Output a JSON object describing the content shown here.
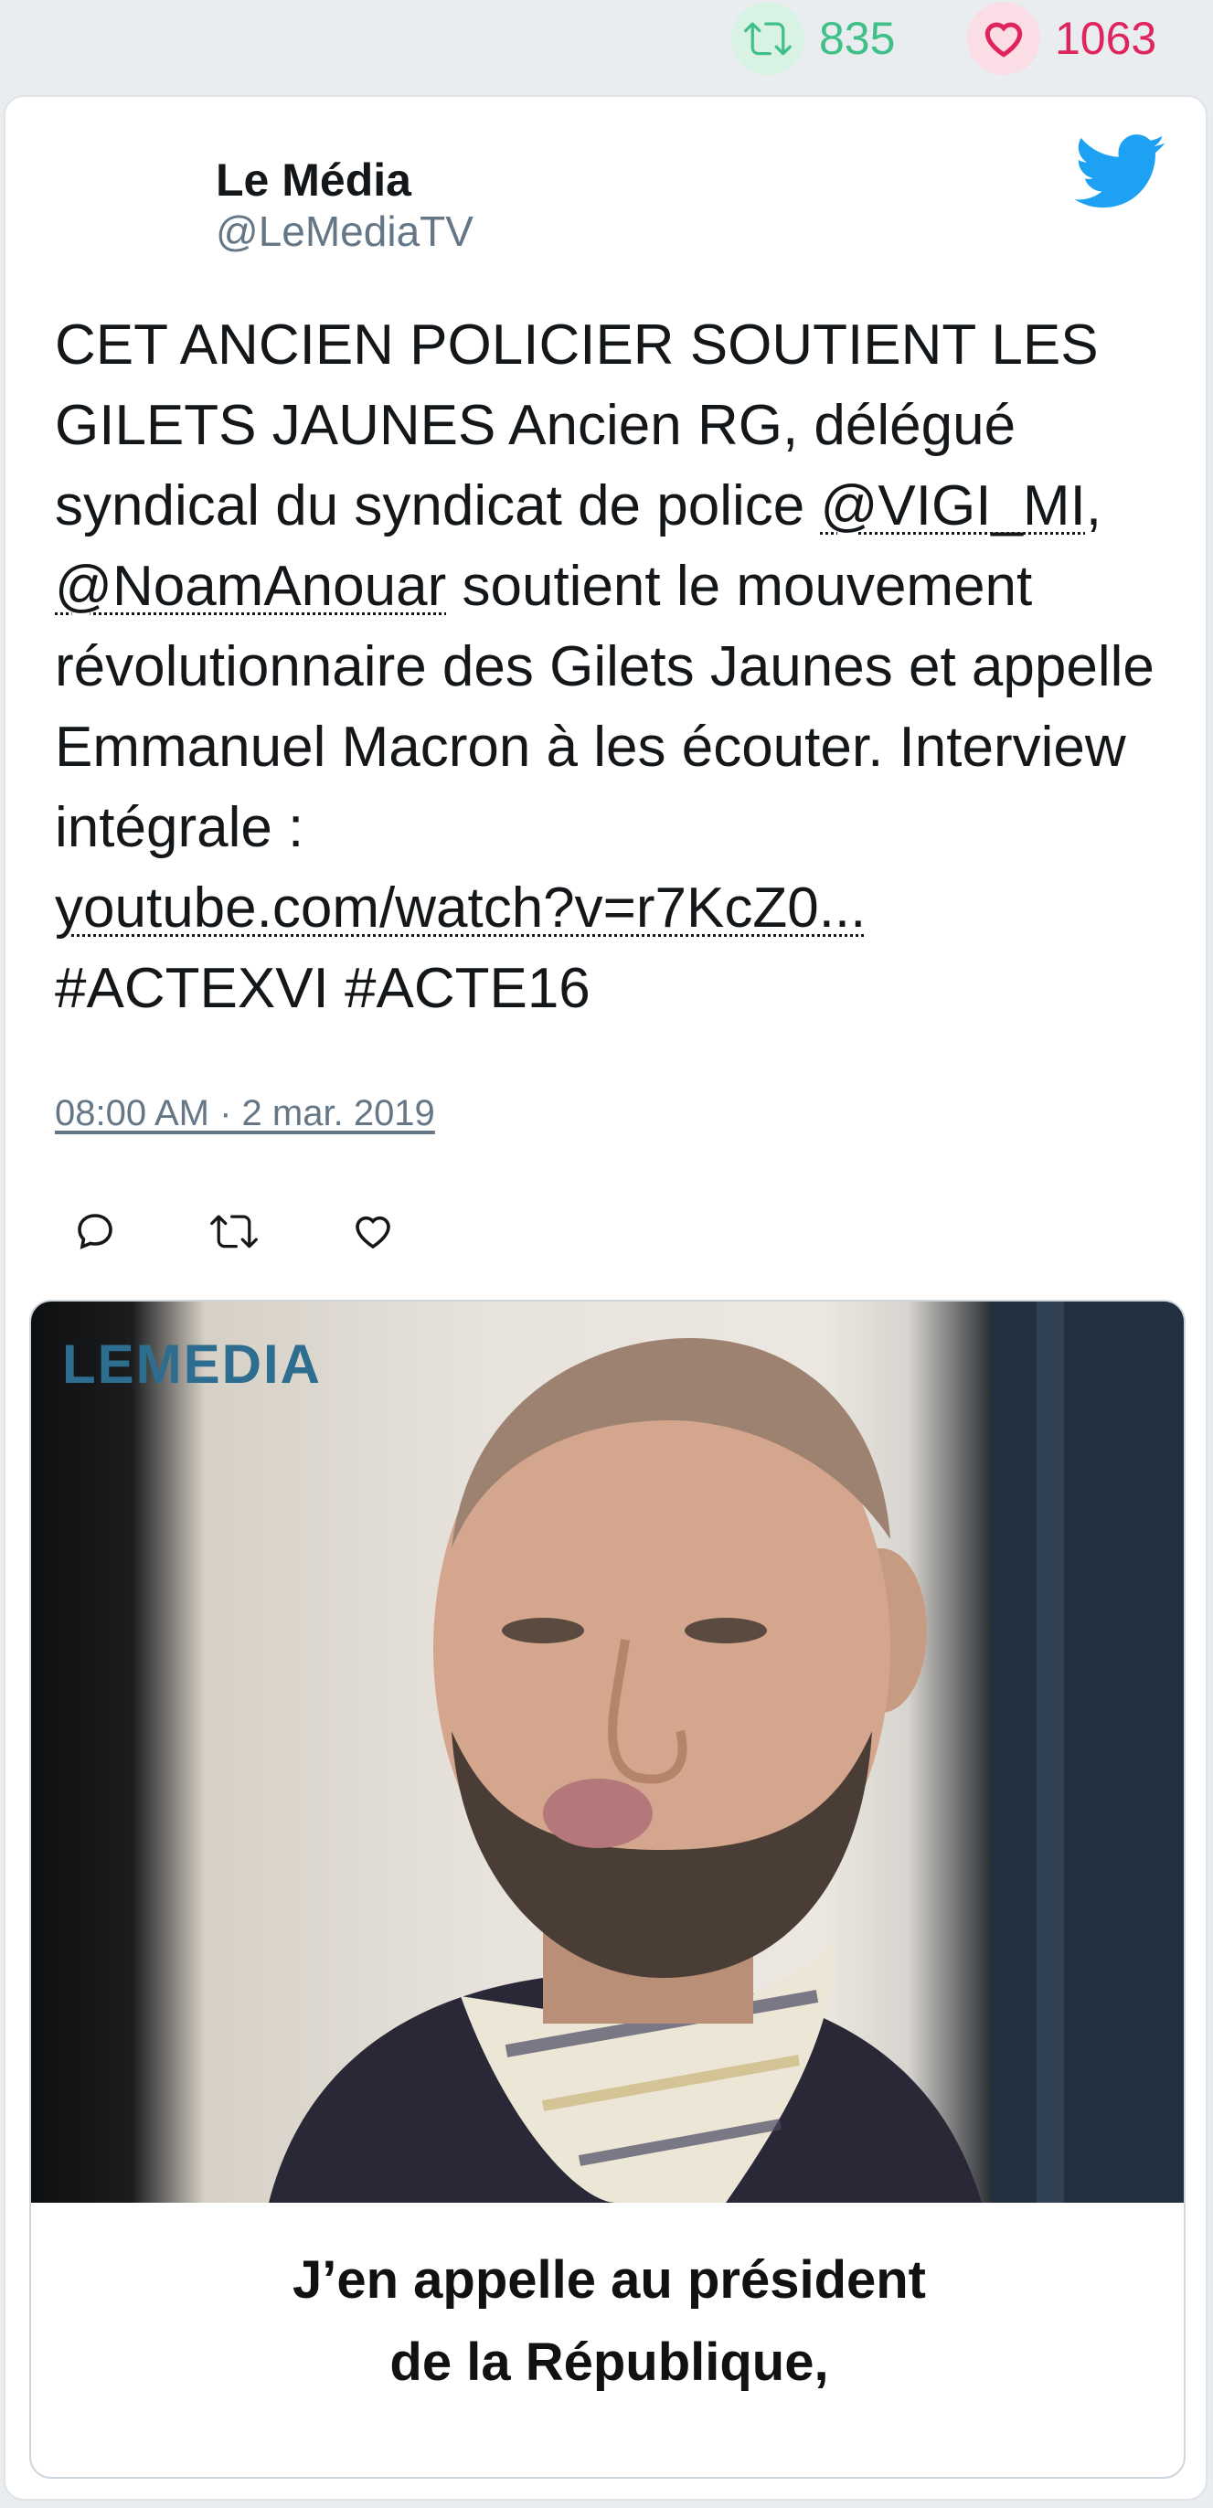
{
  "stats": {
    "retweets": "835",
    "likes": "1063"
  },
  "author": {
    "name": "Le Média",
    "handle": "@LeMediaTV"
  },
  "tweet": {
    "text_1": "CET ANCIEN POLICIER SOUTIENT LES GILETS JAUNES Ancien RG, délégué syndical du syndicat de police ",
    "mention_1": "@VIGI_MI",
    "sep": ", ",
    "mention_2": "@NoamAnouar",
    "text_2": " soutient le mouvement révolutionnaire des Gilets Jaunes et appelle Emmanuel Macron à les écouter. Interview intégrale : ",
    "link": "youtube.com/watch?v=r7KcZ0...",
    "hashtags": "#ACTEXVI #ACTE16"
  },
  "timestamp": "08:00 AM · 2 mar. 2019",
  "media": {
    "logo": "LEMEDIA",
    "caption_line_1": "J’en appelle au président",
    "caption_line_2": "de la République,"
  },
  "colors": {
    "retweet": "#3fc086",
    "like": "#e0245e",
    "twitter_blue": "#1da1f2",
    "secondary_text": "#657786"
  },
  "icons": [
    "retweet-icon",
    "heart-icon",
    "twitter-logo-icon",
    "reply-icon"
  ]
}
